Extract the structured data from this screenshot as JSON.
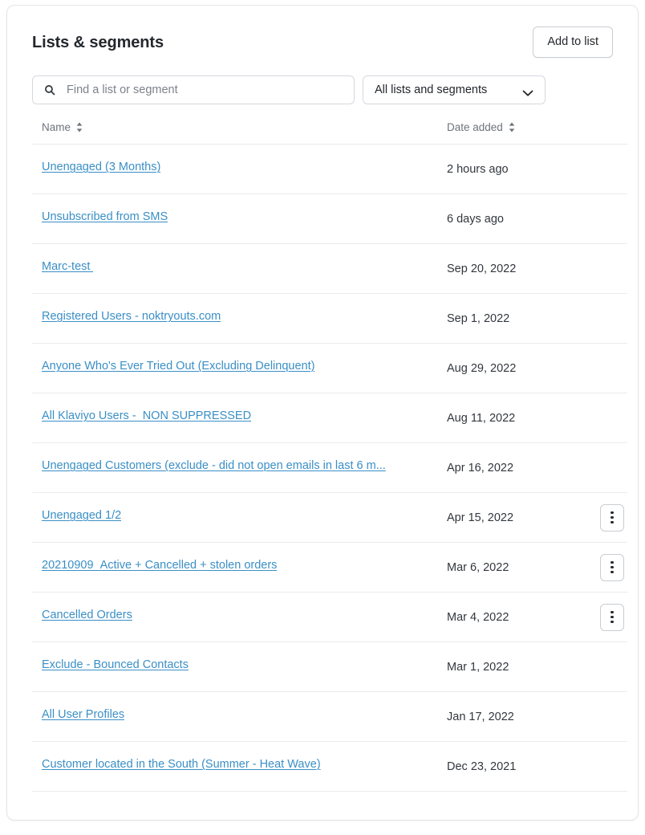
{
  "header": {
    "title": "Lists & segments",
    "add_button_label": "Add to list"
  },
  "filters": {
    "search": {
      "value": "",
      "placeholder": "Find a list or segment",
      "icon": "search-icon"
    },
    "type_select": {
      "selected": "All lists and segments",
      "icon": "chevron-down-icon"
    }
  },
  "table": {
    "columns": [
      {
        "label": "Name",
        "sort_icon": "sort-updown-icon"
      },
      {
        "label": "Date added",
        "sort_icon": "sort-updown-icon"
      }
    ],
    "rows": [
      {
        "name": "Unengaged (3 Months)",
        "date_added": "2 hours ago",
        "has_menu": false
      },
      {
        "name": "Unsubscribed from SMS",
        "date_added": "6 days ago",
        "has_menu": false
      },
      {
        "name": "Marc-test ",
        "date_added": "Sep 20, 2022",
        "has_menu": false
      },
      {
        "name": "Registered Users - noktryouts.com",
        "date_added": "Sep 1, 2022",
        "has_menu": false
      },
      {
        "name": "Anyone Who's Ever Tried Out (Excluding Delinquent)",
        "date_added": "Aug 29, 2022",
        "has_menu": false
      },
      {
        "name": "All Klaviyo Users -  NON SUPPRESSED",
        "date_added": "Aug 11, 2022",
        "has_menu": false
      },
      {
        "name": "Unengaged Customers (exclude - did not open emails in last 6 m...",
        "date_added": "Apr 16, 2022",
        "has_menu": false
      },
      {
        "name": "Unengaged 1/2",
        "date_added": "Apr 15, 2022",
        "has_menu": true
      },
      {
        "name": "20210909_Active + Cancelled + stolen orders",
        "date_added": "Mar 6, 2022",
        "has_menu": true
      },
      {
        "name": "Cancelled Orders",
        "date_added": "Mar 4, 2022",
        "has_menu": true
      },
      {
        "name": "Exclude - Bounced Contacts",
        "date_added": "Mar 1, 2022",
        "has_menu": false
      },
      {
        "name": "All User Profiles",
        "date_added": "Jan 17, 2022",
        "has_menu": false
      },
      {
        "name": "Customer located in the South (Summer - Heat Wave)",
        "date_added": "Dec 23, 2021",
        "has_menu": false
      }
    ],
    "row_menu_label": "row-actions"
  },
  "colors": {
    "link": "#3a8fc6",
    "text": "#24282d",
    "muted": "#6d737b",
    "border": "#e6e8ea",
    "card_border": "#e3e5e8"
  }
}
